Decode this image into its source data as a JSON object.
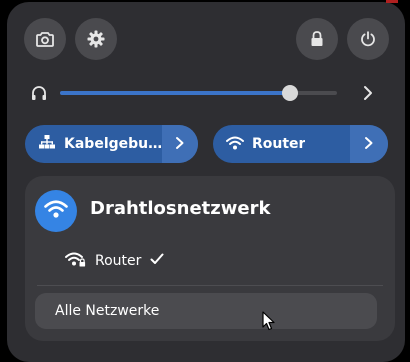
{
  "top_bar": {
    "screenshot_icon": "camera-icon",
    "settings_icon": "gear-icon",
    "lock_icon": "lock-icon",
    "power_icon": "power-icon"
  },
  "volume": {
    "icon": "headphones-icon",
    "level": 0.83,
    "expand_icon": "chevron-right-icon"
  },
  "toggles": {
    "wired": {
      "label": "Kabelgebu…",
      "icon": "network-wired-icon",
      "active": true
    },
    "wifi": {
      "label": "Router",
      "icon": "wifi-icon",
      "active": true
    }
  },
  "wifi_menu": {
    "title": "Drahtlosnetzwerk",
    "networks": [
      {
        "name": "Router",
        "connected": true,
        "secured": true
      }
    ],
    "all_networks_label": "Alle Netzwerke"
  },
  "colors": {
    "panel_bg": "#2e2e32",
    "accent": "#3584e4",
    "toggle_active": "#2d5da2",
    "slider_fill": "#3b74c9"
  }
}
